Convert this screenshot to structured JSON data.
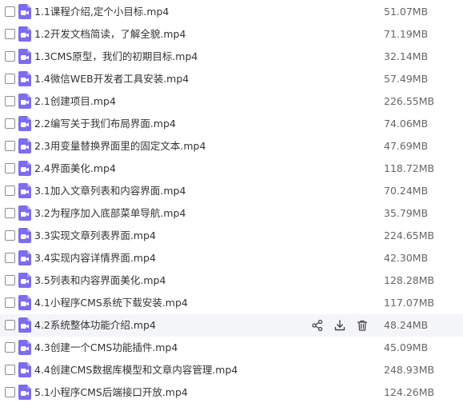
{
  "files": [
    {
      "name": "1.1课程介绍,定个小目标.mp4",
      "size": "51.07MB"
    },
    {
      "name": "1.2开发文档简读，了解全貌.mp4",
      "size": "71.19MB"
    },
    {
      "name": "1.3CMS原型，我们的初期目标.mp4",
      "size": "32.14MB"
    },
    {
      "name": "1.4微信WEB开发者工具安装.mp4",
      "size": "57.49MB"
    },
    {
      "name": "2.1创建项目.mp4",
      "size": "226.55MB"
    },
    {
      "name": "2.2编写关于我们布局界面.mp4",
      "size": "74.06MB"
    },
    {
      "name": "2.3用变量替换界面里的固定文本.mp4",
      "size": "47.69MB"
    },
    {
      "name": "2.4界面美化.mp4",
      "size": "118.72MB"
    },
    {
      "name": "3.1加入文章列表和内容界面.mp4",
      "size": "70.24MB"
    },
    {
      "name": "3.2为程序加入底部菜单导航.mp4",
      "size": "35.79MB"
    },
    {
      "name": "3.3实现文章列表界面.mp4",
      "size": "224.65MB"
    },
    {
      "name": "3.4实现内容详情界面.mp4",
      "size": "42.30MB"
    },
    {
      "name": "3.5列表和内容界面美化.mp4",
      "size": "128.28MB"
    },
    {
      "name": "4.1小程序CMS系统下载安装.mp4",
      "size": "117.07MB"
    },
    {
      "name": "4.2系统整体功能介绍.mp4",
      "size": "48.24MB"
    },
    {
      "name": "4.3创建一个CMS功能插件.mp4",
      "size": "45.09MB"
    },
    {
      "name": "4.4创建CMS数据库模型和文章内容管理.mp4",
      "size": "248.93MB"
    },
    {
      "name": "5.1小程序CMS后端接口开放.mp4",
      "size": "124.26MB"
    }
  ],
  "hovered_index": 14,
  "row_actions": [
    {
      "icon": "share-icon",
      "name": "share-button"
    },
    {
      "icon": "download-icon",
      "name": "download-button"
    },
    {
      "icon": "trash-icon",
      "name": "delete-button"
    }
  ],
  "colors": {
    "video_icon": "#7b6cf0",
    "text": "#333333",
    "size_text": "#666666",
    "hover_bg": "#f4f5f7",
    "action_icon": "#444444"
  }
}
